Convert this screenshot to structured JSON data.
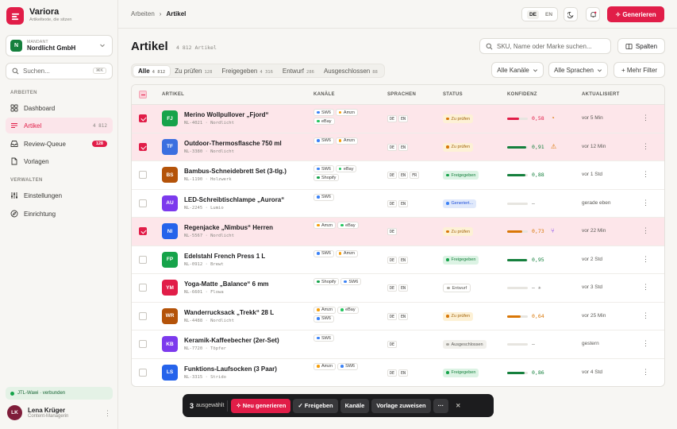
{
  "app": {
    "name": "Variora",
    "tagline": "Artikeltexte, die sitzen",
    "logo_color": "#e11d48"
  },
  "tenant": {
    "label": "MANDANT",
    "name": "Nordlicht GmbH",
    "badge": "N"
  },
  "sidebar_search": {
    "placeholder": "Suchen...",
    "shortcut": "⌘K"
  },
  "sections": {
    "work": "ARBEITEN",
    "manage": "VERWALTEN"
  },
  "nav": {
    "dashboard": "Dashboard",
    "artikel": "Artikel",
    "artikel_count": "4 812",
    "review": "Review-Queue",
    "review_count": "128",
    "vorlagen": "Vorlagen",
    "einstellungen": "Einstellungen",
    "einrichtung": "Einrichtung"
  },
  "sync": "JTL-Wawi · verbunden",
  "user": {
    "initials": "LK",
    "name": "Lena Krüger",
    "role": "Content-Managerin"
  },
  "breadcrumb": {
    "parent": "Arbeiten",
    "current": "Artikel"
  },
  "topbar": {
    "lang_active": "DE",
    "lang_other": "EN",
    "generate": "✧ Generieren"
  },
  "page": {
    "title": "Artikel",
    "count": "4 812 Artikel",
    "search_placeholder": "SKU, Name oder Marke suchen...",
    "columns_button": "Spalten"
  },
  "tabs": [
    {
      "label": "Alle",
      "count": "4 812"
    },
    {
      "label": "Zu prüfen",
      "count": "128"
    },
    {
      "label": "Freigegeben",
      "count": "4 316"
    },
    {
      "label": "Entwurf",
      "count": "286"
    },
    {
      "label": "Ausgeschlossen",
      "count": "88"
    }
  ],
  "filters": {
    "channels": "Alle Kanäle",
    "languages": "Alle Sprachen",
    "more": "+ Mehr Filter"
  },
  "columns": {
    "article": "ARTIKEL",
    "channels": "KANÄLE",
    "languages": "SPRACHEN",
    "status": "STATUS",
    "confidence": "KONFIDENZ",
    "updated": "AKTUALISIERT"
  },
  "channel_colors": {
    "SW6": "#3b82f6",
    "Amzn": "#f59e0b",
    "eBay": "#22c55e",
    "Shopify": "#16a34a"
  },
  "status_styles": {
    "Zu prüfen": {
      "bg": "#fdf1d6",
      "fg": "#a16207",
      "dot": "#d97706"
    },
    "Freigegeben": {
      "bg": "#dcf3e4",
      "fg": "#15803d",
      "dot": "#16a34a"
    },
    "Generiert...": {
      "bg": "#e0e9fb",
      "fg": "#1d4ed8",
      "dot": "#3b82f6"
    },
    "Entwurf": {
      "bg": "#fff",
      "fg": "#5a5955",
      "dot": "#a8a6a0"
    },
    "Ausgeschlossen": {
      "bg": "#f1f0ec",
      "fg": "#5a5955",
      "dot": "#a8a6a0"
    }
  },
  "rows": [
    {
      "selected": true,
      "initials": "FJ",
      "color": "#16a34a",
      "title": "Merino Wollpullover „Fjord“",
      "sku": "NL-4021 · Nordlicht",
      "channels": [
        "SW6",
        "Amzn",
        "eBay"
      ],
      "languages": [
        "DE",
        "EN"
      ],
      "status": "Zu prüfen",
      "confidence": 0.58,
      "confidence_label": "0,58",
      "conf_color": "#e11d48",
      "conf_icon": "◔",
      "conf_icon_color": "#d97706",
      "updated": "vor 5 Min"
    },
    {
      "selected": true,
      "initials": "TF",
      "color": "#3b6fe0",
      "title": "Outdoor-Thermosflasche 750 ml",
      "sku": "NL-3380 · Nordlicht",
      "channels": [
        "SW6",
        "Amzn"
      ],
      "languages": [
        "DE",
        "EN"
      ],
      "status": "Zu prüfen",
      "confidence": 0.91,
      "confidence_label": "0,91",
      "conf_color": "#15803d",
      "conf_icon": "⚠",
      "conf_icon_color": "#d97706",
      "updated": "vor 12 Min"
    },
    {
      "selected": false,
      "initials": "BS",
      "color": "#b45309",
      "title": "Bambus-Schneidebrett Set (3-tlg.)",
      "sku": "NL-1190 · Holzwerk",
      "channels": [
        "SW6",
        "eBay",
        "Shopify"
      ],
      "languages": [
        "DE",
        "EN",
        "FR"
      ],
      "status": "Freigegeben",
      "confidence": 0.88,
      "confidence_label": "0,88",
      "conf_color": "#15803d",
      "conf_icon": "",
      "conf_icon_color": "#000",
      "updated": "vor 1 Std"
    },
    {
      "selected": false,
      "initials": "AU",
      "color": "#7c3aed",
      "title": "LED-Schreibtischlampe „Aurora“",
      "sku": "NL-2245 · Lumio",
      "channels": [
        "SW6"
      ],
      "languages": [
        "DE",
        "EN"
      ],
      "status": "Generiert...",
      "confidence": 0,
      "confidence_label": "—",
      "conf_color": "#e7e5e0",
      "conf_icon": "",
      "conf_icon_color": "#000",
      "updated": "gerade eben"
    },
    {
      "selected": true,
      "initials": "NI",
      "color": "#2563eb",
      "title": "Regenjacke „Nimbus“ Herren",
      "sku": "NL-5567 · Nordlicht",
      "channels": [
        "Amzn",
        "eBay"
      ],
      "languages": [
        "DE"
      ],
      "status": "Zu prüfen",
      "confidence": 0.73,
      "confidence_label": "0,73",
      "conf_color": "#d97706",
      "conf_icon": "⑂",
      "conf_icon_color": "#7c3aed",
      "updated": "vor 22 Min"
    },
    {
      "selected": false,
      "initials": "FP",
      "color": "#16a34a",
      "title": "Edelstahl French Press 1 L",
      "sku": "NL-0912 · Brewt",
      "channels": [
        "SW6",
        "Amzn"
      ],
      "languages": [
        "DE",
        "EN"
      ],
      "status": "Freigegeben",
      "confidence": 0.95,
      "confidence_label": "0,95",
      "conf_color": "#15803d",
      "conf_icon": "",
      "conf_icon_color": "#000",
      "updated": "vor 2 Std"
    },
    {
      "selected": false,
      "initials": "YM",
      "color": "#e11d48",
      "title": "Yoga-Matte „Balance“ 6 mm",
      "sku": "NL-6601 · Flowa",
      "channels": [
        "Shopify",
        "SW6"
      ],
      "languages": [
        "DE",
        "EN"
      ],
      "status": "Entwurf",
      "confidence": 0,
      "confidence_label": "— ✳",
      "conf_color": "#e7e5e0",
      "conf_icon": "",
      "conf_icon_color": "#000",
      "updated": "vor 3 Std"
    },
    {
      "selected": false,
      "initials": "WR",
      "color": "#b45309",
      "title": "Wanderrucksack „Trekk“ 28 L",
      "sku": "NL-4488 · Nordlicht",
      "channels": [
        "Amzn",
        "eBay",
        "SW6"
      ],
      "languages": [
        "DE",
        "EN"
      ],
      "status": "Zu prüfen",
      "confidence": 0.64,
      "confidence_label": "0,64",
      "conf_color": "#d97706",
      "conf_icon": "",
      "conf_icon_color": "#000",
      "updated": "vor 25 Min"
    },
    {
      "selected": false,
      "initials": "KB",
      "color": "#7c3aed",
      "title": "Keramik-Kaffeebecher (2er-Set)",
      "sku": "NL-7720 · Töpfer",
      "channels": [
        "SW6"
      ],
      "languages": [
        "DE"
      ],
      "status": "Ausgeschlossen",
      "confidence": 0,
      "confidence_label": "—",
      "conf_color": "#e7e5e0",
      "conf_icon": "",
      "conf_icon_color": "#000",
      "updated": "gestern"
    },
    {
      "selected": false,
      "initials": "LS",
      "color": "#2563eb",
      "title": "Funktions-Laufsocken (3 Paar)",
      "sku": "NL-3315 · Strido",
      "channels": [
        "Amzn",
        "SW6"
      ],
      "languages": [
        "DE",
        "EN"
      ],
      "status": "Freigegeben",
      "confidence": 0.86,
      "confidence_label": "0,86",
      "conf_color": "#15803d",
      "conf_icon": "",
      "conf_icon_color": "#000",
      "updated": "vor 4 Std"
    }
  ],
  "bulk": {
    "count": "3",
    "label": "ausgewählt",
    "regenerate": "✧ Neu generieren",
    "approve": "✓ Freigeben",
    "channels": "Kanäle",
    "template": "Vorlage zuweisen",
    "more": "···",
    "close": "✕"
  }
}
